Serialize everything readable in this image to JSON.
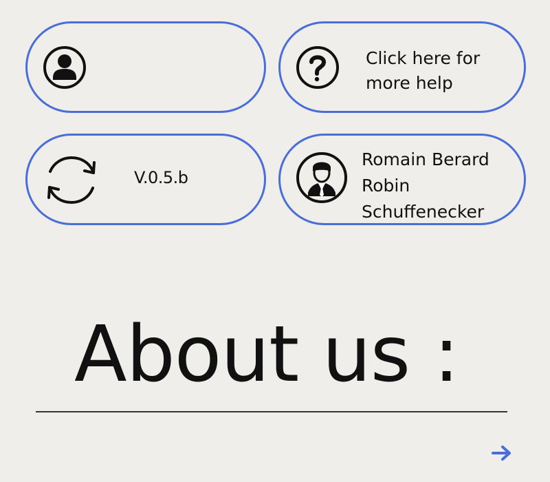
{
  "cards": {
    "profile": {
      "icon": "user-avatar-icon"
    },
    "help": {
      "icon": "question-mark-icon",
      "line1": "Click here for",
      "line2": "more help"
    },
    "version": {
      "icon": "refresh-icon",
      "label": "V.0.5.b"
    },
    "authors": {
      "icon": "businessman-icon",
      "names": [
        "Romain Berard",
        "Robin",
        "Schuffenecker"
      ]
    }
  },
  "about": {
    "title": "About us :"
  },
  "navigation": {
    "next_icon": "arrow-right-icon"
  },
  "colors": {
    "background": "#efeeeb",
    "border": "#4a6ed8",
    "text": "#111111",
    "arrow": "#4a6ed8"
  }
}
